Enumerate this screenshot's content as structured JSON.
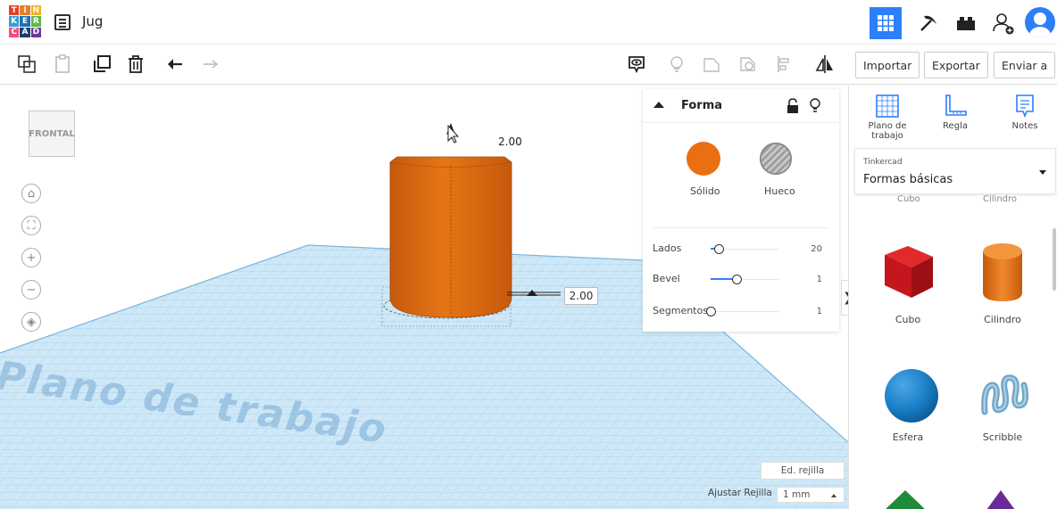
{
  "header": {
    "logo_letters": [
      "T",
      "I",
      "N",
      "K",
      "E",
      "R",
      "C",
      "A",
      "D"
    ],
    "logo_colors": [
      "#e2402a",
      "#e87f29",
      "#f0b323",
      "#3a9ad9",
      "#1c6fb5",
      "#63b546",
      "#ef4e7c",
      "#1c3d6e",
      "#6a3b97"
    ],
    "design_name": "Jug",
    "views": [
      "3d-design-grid-icon",
      "pickaxe-icon",
      "bricks-icon"
    ],
    "active_view": "3d-design-grid-icon",
    "accent": "#2d7ff9"
  },
  "toolbar": {
    "left_tools": [
      "copy-icon",
      "paste-icon",
      "duplicate-icon",
      "trash-icon",
      "undo-icon",
      "redo-icon"
    ],
    "right_tools": [
      "eye-visibility-icon",
      "light-bulb-icon",
      "group-icon",
      "ungroup-icon",
      "align-icon",
      "mirror-icon"
    ],
    "import_label": "Importar",
    "export_label": "Exportar",
    "send_label": "Enviar a"
  },
  "viewport": {
    "viewcube_label": "FRONTAL",
    "nav_buttons": [
      "home-icon",
      "fit-view-icon",
      "zoom-in-icon",
      "zoom-out-icon",
      "perspective-icon"
    ],
    "dimension_top": "2.00",
    "dimension_side": "2.00",
    "workplane_label": "Plano de trabajo",
    "grid_edit_label": "Ed. rejilla",
    "snap_grid_label": "Ajustar Rejilla",
    "snap_grid_value": "1 mm",
    "shape_color": "#e37016",
    "grid_color": "#b8dcf3"
  },
  "inspector": {
    "title": "Forma",
    "solid_label": "Sólido",
    "hole_label": "Hueco",
    "solid_color": "#ea6f12",
    "properties": [
      {
        "label": "Lados",
        "value": "20",
        "fraction": 0.12
      },
      {
        "label": "Bevel",
        "value": "1",
        "fraction": 0.38
      },
      {
        "label": "Segmentos",
        "value": "1",
        "fraction": 0.0
      }
    ]
  },
  "right_panel": {
    "tools": [
      {
        "label": "Plano de trabajo",
        "icon": "workplane-icon"
      },
      {
        "label": "Regla",
        "icon": "ruler-icon"
      },
      {
        "label": "Notes",
        "icon": "notes-icon"
      }
    ],
    "library_provider": "Tinkercad",
    "library_name": "Formas básicas",
    "partial_labels": [
      "Cubo",
      "Cilindro"
    ],
    "shapes": [
      {
        "name": "Cubo",
        "color": "#c4161c"
      },
      {
        "name": "Cilindro",
        "color": "#e37016"
      },
      {
        "name": "Esfera",
        "color": "#1a7fc8"
      },
      {
        "name": "Scribble",
        "color": "#6fa5c8"
      }
    ]
  }
}
